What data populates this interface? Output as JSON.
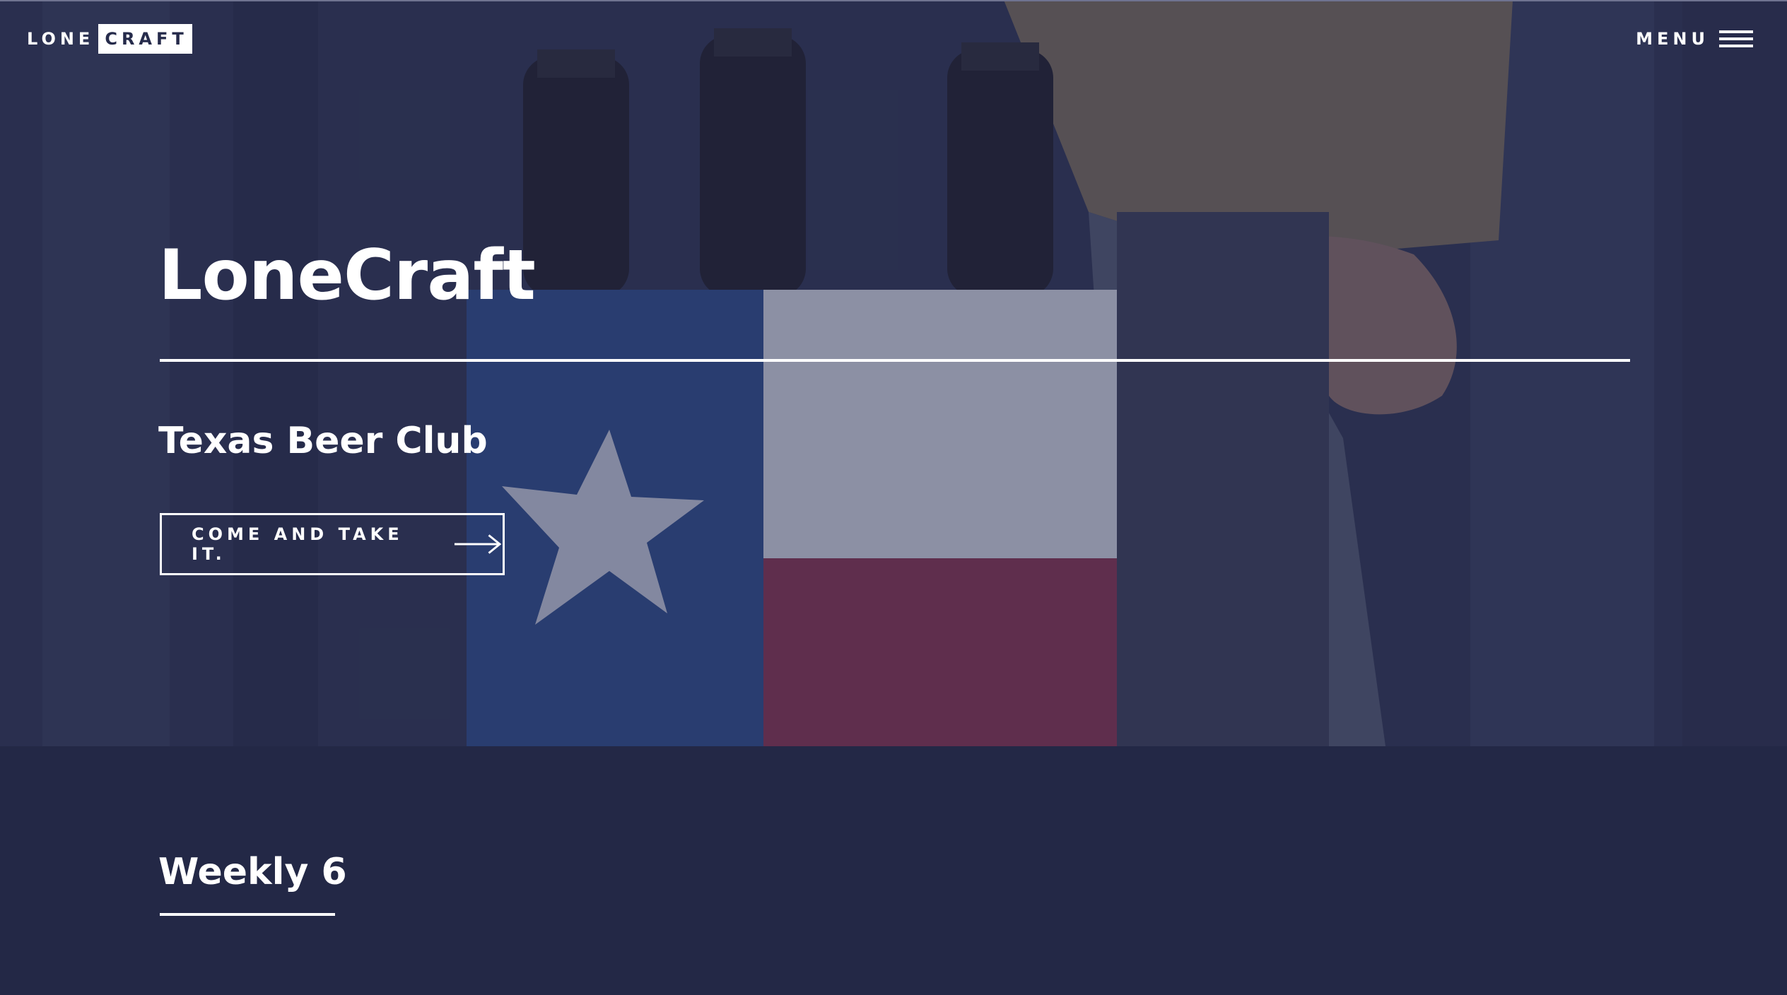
{
  "header": {
    "logo_part1": "LONE",
    "logo_part2": "CRAFT",
    "menu_label": "MENU"
  },
  "hero": {
    "title": "LoneCraft",
    "subtitle": "Texas Beer Club",
    "cta_label": "COME AND TAKE IT."
  },
  "section": {
    "title": "Weekly 6"
  },
  "colors": {
    "background_navy": "#232846",
    "text": "#ffffff",
    "flag_blue": "#2e4c8c",
    "flag_red": "#8a3350",
    "flag_white": "#d8dbe6"
  },
  "icons": {
    "menu": "hamburger-icon",
    "cta": "arrow-right-icon"
  }
}
